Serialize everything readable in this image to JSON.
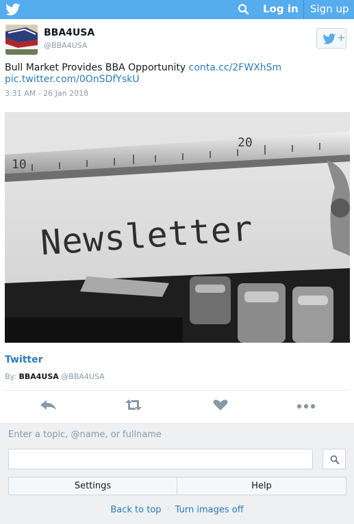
{
  "header": {
    "login_label": "Log in",
    "signup_label": "Sign up",
    "icons": [
      "twitter-bird-icon",
      "search-icon"
    ],
    "bar_color": "#55acee"
  },
  "profile": {
    "name": "BBA4USA",
    "handle": "@BBA4USA",
    "follow_plus": "+"
  },
  "tweet": {
    "text": "Bull Market Provides BBA Opportunity",
    "link": "conta.cc/2FWXhSm",
    "pic_link": "pic.twitter.com/0OnSDfYskU",
    "timestamp": "3:31 AM - 26 Jan 2018",
    "image_word": "Newsletter",
    "ruler_numbers": [
      "10",
      "20"
    ]
  },
  "card": {
    "title": "Twitter",
    "by_prefix": "By:",
    "by_name": "BBA4USA",
    "by_handle": "@BBA4USA"
  },
  "actions": {
    "icons": [
      "reply-icon",
      "retweet-icon",
      "like-icon",
      "more-icon"
    ]
  },
  "footer": {
    "hint": "Enter a topic, @name, or fullname",
    "search_value": "",
    "settings_label": "Settings",
    "help_label": "Help",
    "back_to_top": "Back to top",
    "separator": "·",
    "images_off": "Turn images off"
  },
  "colors": {
    "link": "#2b7bb9",
    "muted": "#8899a6",
    "footer_bg": "#eef0f2"
  }
}
